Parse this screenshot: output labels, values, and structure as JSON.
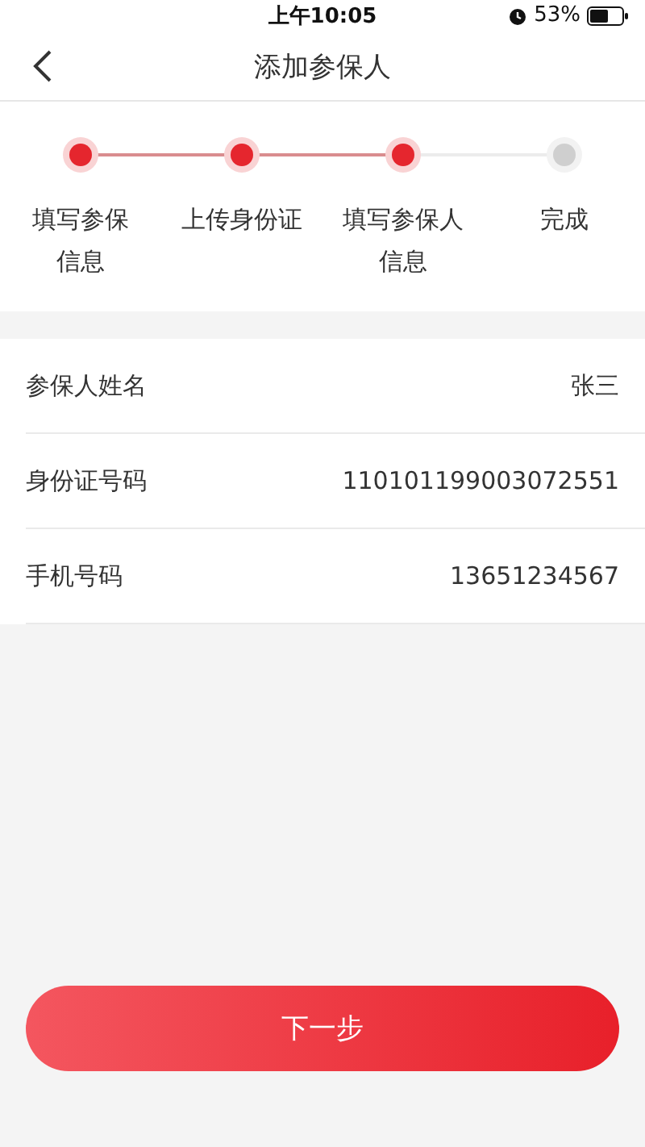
{
  "status_bar": {
    "time": "上午10:05",
    "battery": "53%"
  },
  "nav": {
    "title": "添加参保人"
  },
  "steps": [
    {
      "label_lines": [
        "填写参保",
        "信息"
      ],
      "completed": true
    },
    {
      "label_lines": [
        "上传身份证"
      ],
      "completed": true
    },
    {
      "label_lines": [
        "填写参保人",
        "信息"
      ],
      "completed": true
    },
    {
      "label_lines": [
        "完成"
      ],
      "completed": false
    }
  ],
  "fields": [
    {
      "label": "参保人姓名",
      "value": "张三"
    },
    {
      "label": "身份证号码",
      "value": "110101199003072551"
    },
    {
      "label": "手机号码",
      "value": "13651234567"
    }
  ],
  "next_button": "下一步"
}
